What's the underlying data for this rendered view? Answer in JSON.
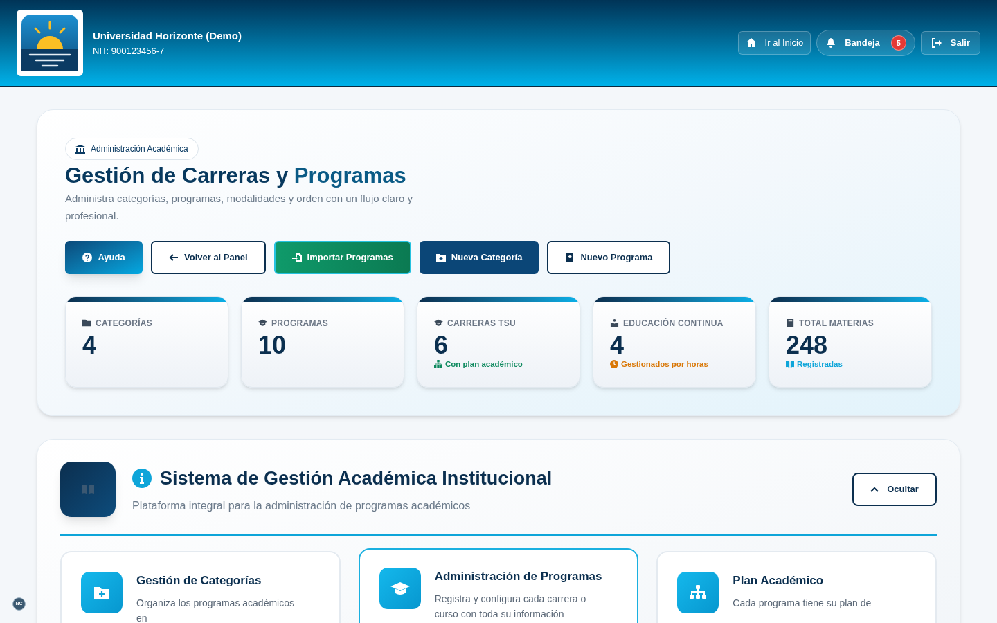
{
  "header": {
    "org_name": "Universidad Horizonte (Demo)",
    "org_id": "NIT: 900123456-7",
    "nav": [
      {
        "kind": "home",
        "label": "Ir al Inicio"
      },
      {
        "kind": "inbox",
        "label": "Bandeja",
        "count": "5"
      },
      {
        "kind": "logout",
        "label": "Salir"
      }
    ]
  },
  "hero": {
    "badge": "Administración Académica",
    "title_part1": "Gestión de Carreras y",
    "title_part2": "Programas",
    "subtitle": "Administra categorías, programas, modalidades y orden con un flujo claro y profesional.",
    "actions": [
      {
        "kind": "help",
        "label": "Ayuda"
      },
      {
        "kind": "outline",
        "label": "Volver al Panel"
      },
      {
        "kind": "import",
        "label": "Importar Programas"
      },
      {
        "kind": "primary",
        "label": "Nueva Categoría"
      },
      {
        "kind": "outline",
        "label": "Nuevo Programa"
      }
    ],
    "stats": [
      {
        "label": "CATEGORÍAS",
        "value": "4"
      },
      {
        "label": "PROGRAMAS",
        "value": "10"
      },
      {
        "label": "CARRERAS TSU",
        "value": "6",
        "note": "Con plan académico",
        "color": "#0f8a5f"
      },
      {
        "label": "EDUCACIÓN CONTINUA",
        "value": "4",
        "note": "Gestionados por horas",
        "color": "#d97706"
      },
      {
        "label": "TOTAL MATERIAS",
        "value": "248",
        "note": "Registradas",
        "color": "#0ea5d9"
      }
    ]
  },
  "info": {
    "title": "Sistema de Gestión Académica Institucional",
    "subtitle": "Plataforma integral para la administración de programas académicos",
    "toggle": "Ocultar",
    "features": [
      {
        "title": "Gestión de Categorías",
        "text": "Organiza los programas académicos en",
        "selected": false
      },
      {
        "title": "Administración de Programas",
        "text": "Registra y configura cada carrera o curso con toda su información",
        "selected": true
      },
      {
        "title": "Plan Académico",
        "text": "Cada programa tiene su plan de",
        "selected": false
      }
    ]
  },
  "corner_badge": "NC"
}
